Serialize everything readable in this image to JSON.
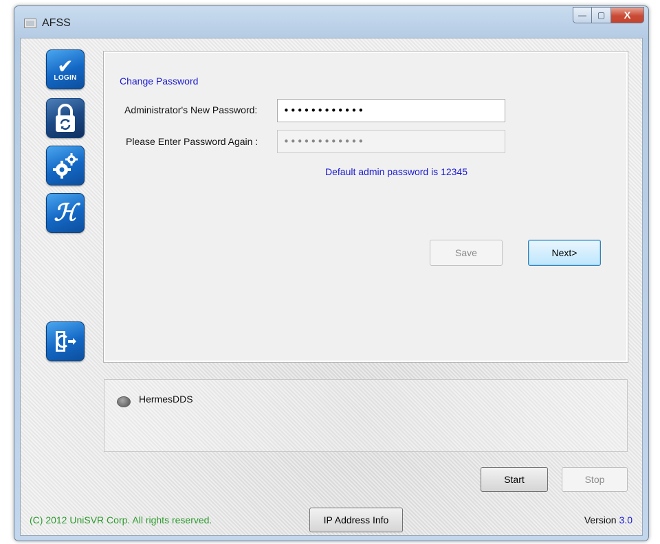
{
  "window": {
    "title": "AFSS",
    "controls": {
      "minimize": "—",
      "maximize": "▢",
      "close": "X"
    }
  },
  "sidebar": {
    "items": [
      {
        "name": "login",
        "label": "LOGIN",
        "icon": "login-check-icon"
      },
      {
        "name": "change-password",
        "icon": "padlock-refresh-icon"
      },
      {
        "name": "settings",
        "icon": "gears-icon"
      },
      {
        "name": "hermes",
        "glyph": "ℋ",
        "icon": "hermes-h-icon"
      },
      {
        "name": "exit",
        "icon": "exit-door-icon"
      }
    ]
  },
  "form": {
    "title": "Change Password",
    "new_password_label": "Administrator's New Password:",
    "new_password_value": "••••••••••••",
    "confirm_password_label": "Please Enter Password Again :",
    "confirm_password_value": "••••••••••••",
    "hint": "Default admin password is 12345",
    "save_label": "Save",
    "next_label": "Next>"
  },
  "service": {
    "name": "HermesDDS",
    "status_color": "#7a7a7a"
  },
  "controls": {
    "start_label": "Start",
    "stop_label": "Stop",
    "ip_label": "IP Address Info"
  },
  "footer": {
    "copyright": "(C) 2012 UniSVR Corp. All rights reserved.",
    "version_label": "Version",
    "version_number": "3.0"
  },
  "colors": {
    "link_blue": "#1a1acf",
    "copyright_green": "#2e9a2e",
    "sidebar_blue": "#1367c4"
  }
}
